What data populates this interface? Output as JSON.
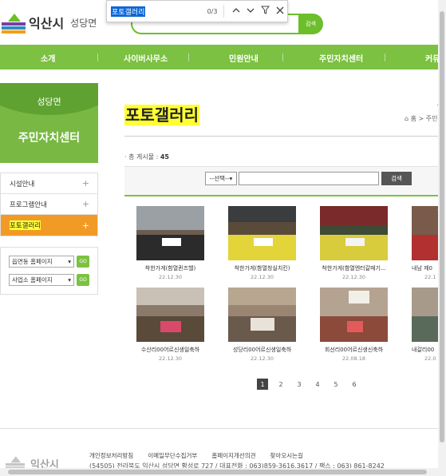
{
  "header": {
    "logo_text": "익산시",
    "logo_sub": "성당면",
    "search_btn": "검색"
  },
  "findbar": {
    "query": "포토갤러리",
    "count": "0/3",
    "icons": [
      "chevron-up-icon",
      "chevron-down-icon",
      "filter-icon",
      "close-icon"
    ]
  },
  "nav": {
    "items": [
      "소개",
      "사이버사무소",
      "민원안내",
      "주민자치센터",
      "커뮤"
    ]
  },
  "sidebar": {
    "top_label": "성당면",
    "section_title": "주민자치센터",
    "items": [
      {
        "label": "시설안내",
        "active": false
      },
      {
        "label": "프로그램안내",
        "active": false
      },
      {
        "label": "포토갤러리",
        "active": true
      }
    ],
    "selects": [
      {
        "value": "읍면동 홈페이지",
        "go": "GO"
      },
      {
        "value": "사업소 홈페이지",
        "go": "GO"
      }
    ]
  },
  "main": {
    "title": "포토갤러리",
    "breadcrumb": "홈 > 주민",
    "total_label": "· 총 게시물 : ",
    "total_count": "45",
    "search": {
      "select_value": "--선택--",
      "button": "검색"
    },
    "gallery": [
      {
        "caption": "착한가게(함열퀸즈헬)",
        "date": "22.12.30"
      },
      {
        "caption": "착한가게(함열청실치킨)",
        "date": "22.12.30"
      },
      {
        "caption": "착한가게(함열엔터갈매기...",
        "date": "22.12.30"
      },
      {
        "caption": "내남 제0",
        "date": "22.1"
      },
      {
        "caption": "수산리00어르신생일축하",
        "date": "22.12.30"
      },
      {
        "caption": "성당리00어르신생일축하",
        "date": "22.12.30"
      },
      {
        "caption": "회선리00어르신생신축하",
        "date": "22.08.18"
      },
      {
        "caption": "내갈리00",
        "date": "22.0"
      }
    ],
    "pages": [
      "1",
      "2",
      "3",
      "4",
      "5",
      "6"
    ],
    "current_page": "1"
  },
  "footer": {
    "links": [
      "개인정보처리방침",
      "이메일무단수집거부",
      "홈페이지개선의견",
      "찾아오시는길"
    ],
    "address": "(54505) 전라북도 익산시 성당면 황성로 727 / 대표전화 : 063)859-3616,3617 / 팩스 : 063) 861-8242",
    "logo_text": "익산시"
  },
  "colors": {
    "brand_green": "#7cc142",
    "sidebar_green": "#78b843",
    "active_orange": "#f29a26",
    "highlight_yellow": "#ffff33"
  }
}
